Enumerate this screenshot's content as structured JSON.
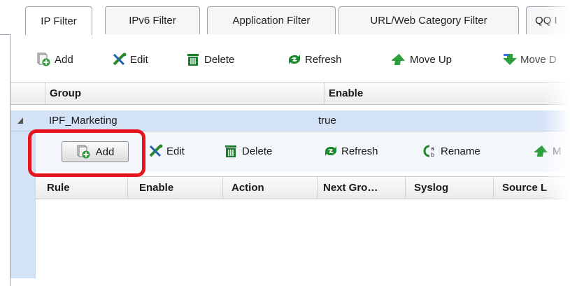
{
  "tabs": [
    {
      "label": "IP Filter",
      "active": true
    },
    {
      "label": "IPv6 Filter",
      "active": false
    },
    {
      "label": "Application Filter",
      "active": false
    },
    {
      "label": "URL/Web Category Filter",
      "active": false
    },
    {
      "label": "QQ I",
      "active": false
    }
  ],
  "toolbar": {
    "add": "Add",
    "edit": "Edit",
    "delete": "Delete",
    "refresh": "Refresh",
    "move_up": "Move Up",
    "move_down": "Move D"
  },
  "group_table": {
    "columns": [
      "Group",
      "Enable"
    ],
    "rows": [
      {
        "group": "IPF_Marketing",
        "enable": "true"
      }
    ]
  },
  "rule_toolbar": {
    "add": "Add",
    "edit": "Edit",
    "delete": "Delete",
    "refresh": "Refresh",
    "rename": "Rename",
    "move": "M"
  },
  "rule_table": {
    "columns": [
      "Rule",
      "Enable",
      "Action",
      "Next Gro…",
      "Syslog",
      "Source L"
    ]
  },
  "colors": {
    "highlight": "#e8141c",
    "selected_row": "#d4e2f5",
    "add_icon": "#2e9a3a",
    "delete_icon": "#1f7a2e",
    "refresh_icon": "#1c8a2c"
  }
}
